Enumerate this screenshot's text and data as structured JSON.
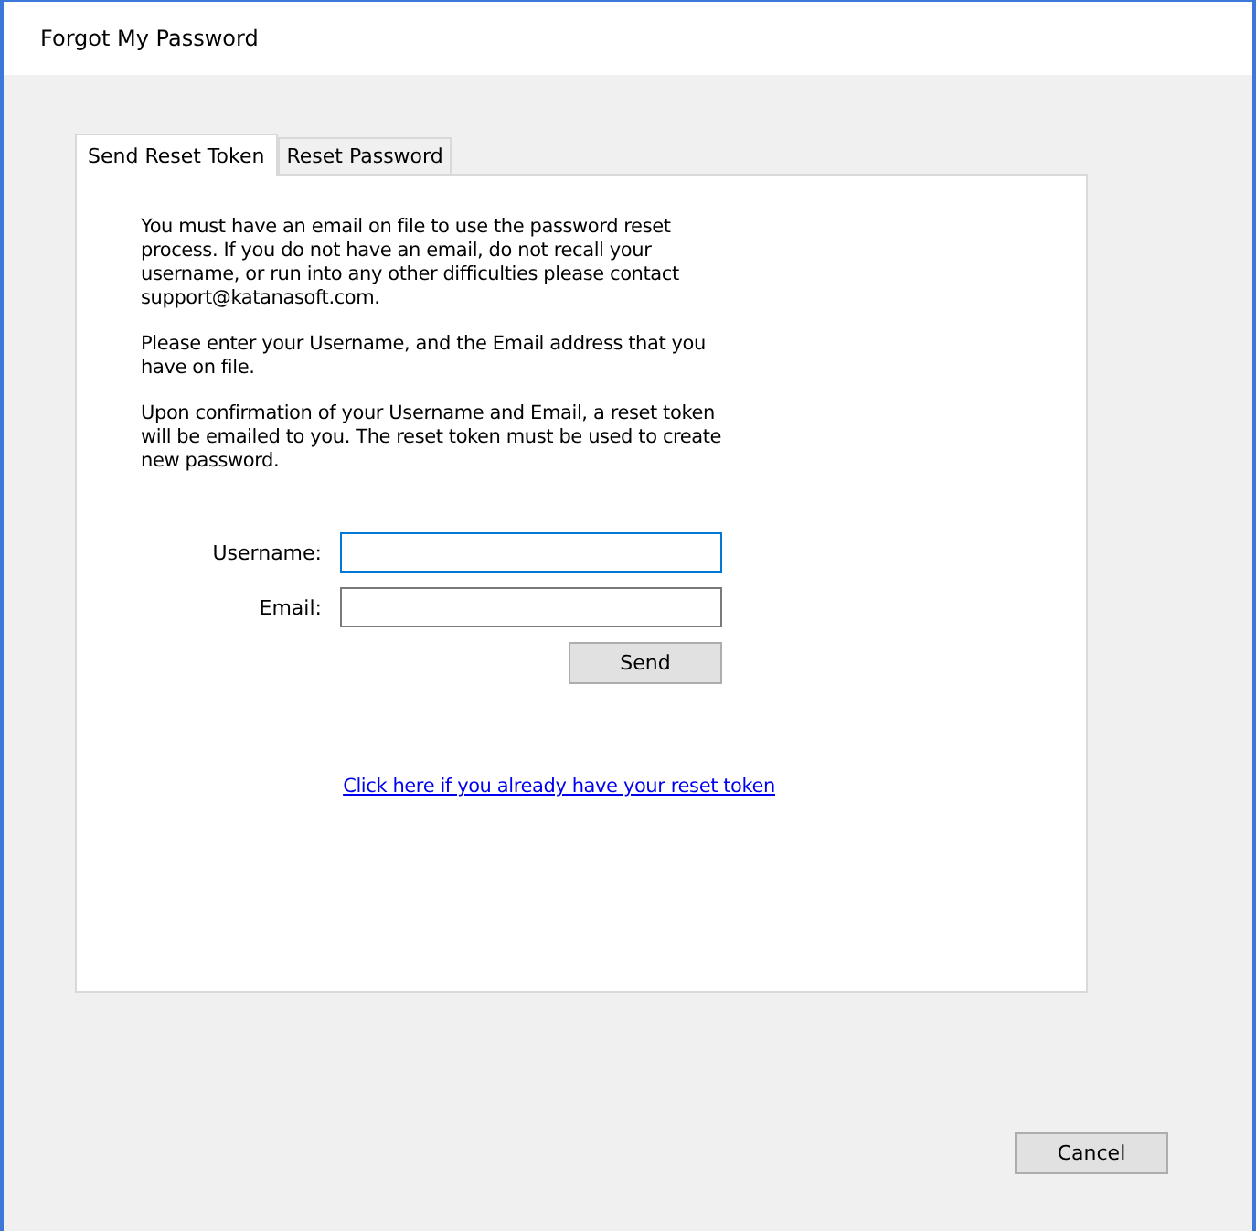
{
  "window": {
    "title": "Forgot My Password"
  },
  "tabs": [
    {
      "label": "Send Reset Token",
      "selected": true
    },
    {
      "label": "Reset Password",
      "selected": false
    }
  ],
  "paragraphs": [
    "You must have an email on file to use the password reset process. If you do not have an email, do not recall your username, or run into any other difficulties please contact support@katanasoft.com.",
    "Please enter your Username, and the Email address that you have on file.",
    "Upon confirmation of your Username and Email, a reset token will be emailed to you.  The reset token must be used to create new password."
  ],
  "fields": [
    {
      "label": "Username:",
      "focused": true
    },
    {
      "label": "Email:",
      "focused": false
    }
  ],
  "send_button": "Send",
  "link": "Click here if you already have your reset token",
  "cancel_button": "Cancel"
}
